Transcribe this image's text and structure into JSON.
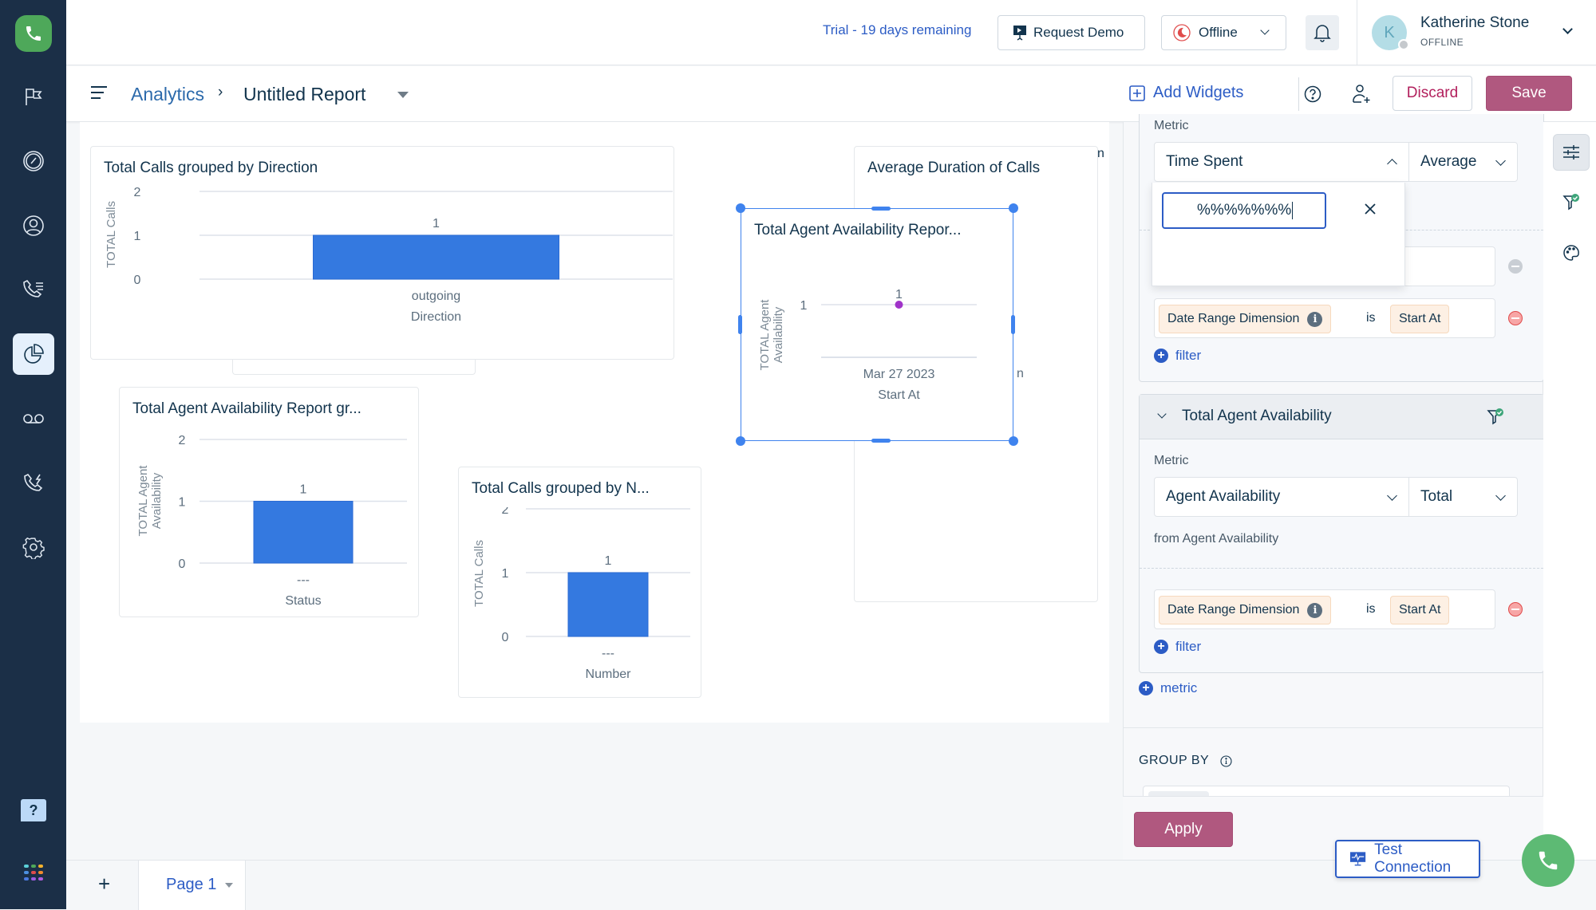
{
  "sidebar": {
    "items": [
      {
        "name": "phone-logo",
        "icon": "phone-icon"
      },
      {
        "name": "tickets",
        "icon": "flag-icon"
      },
      {
        "name": "dashboard",
        "icon": "speedometer-icon"
      },
      {
        "name": "contacts",
        "icon": "user-circle-icon"
      },
      {
        "name": "call-queues",
        "icon": "phone-list-icon"
      },
      {
        "name": "analytics",
        "icon": "pie-chart-icon",
        "active": true
      },
      {
        "name": "voicemail",
        "icon": "voicemail-icon"
      },
      {
        "name": "call-routing",
        "icon": "phone-forward-icon"
      },
      {
        "name": "settings",
        "icon": "gear-icon"
      },
      {
        "name": "help",
        "icon": "help-icon",
        "label": "?"
      },
      {
        "name": "apps",
        "icon": "apps-grid-icon"
      }
    ]
  },
  "topbar": {
    "trial_text": "Trial - 19 days remaining",
    "request_demo_label": "Request Demo",
    "status_select": "Offline",
    "user": {
      "name": "Katherine Stone",
      "status": "OFFLINE",
      "initial": "K"
    }
  },
  "subbar": {
    "breadcrumb_root": "Analytics",
    "breadcrumb_sep": "›",
    "report_title": "Untitled Report",
    "add_widgets_label": "Add Widgets",
    "discard_label": "Discard",
    "save_label": "Save"
  },
  "widgets": {
    "w1": {
      "title": "Total Calls grouped by Direction"
    },
    "w2": {
      "title": "Average Duration of Calls"
    },
    "w3": {
      "title": "Total Agent Availability Repor..."
    },
    "w4": {
      "title": "Total Agent Availability Report gr..."
    },
    "w5": {
      "title": "Total Calls grouped by N..."
    },
    "partial_text": "n"
  },
  "chart_data": [
    {
      "type": "bar",
      "title": "Total Calls grouped by Direction",
      "categories": [
        "outgoing"
      ],
      "values": [
        1
      ],
      "data_labels": [
        "1"
      ],
      "xlabel": "Direction",
      "ylabel": "TOTAL Calls",
      "yticks": [
        "0",
        "1",
        "2"
      ],
      "ylim": [
        0,
        2
      ],
      "grid": true,
      "color": "#3479e0"
    },
    {
      "type": "line",
      "title": "Total Agent Availability Repor...",
      "categories": [
        "Mar 27 2023"
      ],
      "values": [
        1
      ],
      "data_labels": [
        "1"
      ],
      "xlabel": "Start At",
      "ylabel": "TOTAL Agent Availability",
      "yticks": [
        "1"
      ],
      "grid": true,
      "color": "#a033c9"
    },
    {
      "type": "bar",
      "title": "Total Agent Availability Report gr...",
      "categories": [
        "---"
      ],
      "values": [
        1
      ],
      "data_labels": [
        "1"
      ],
      "xlabel": "Status",
      "ylabel": "TOTAL Agent Availability",
      "yticks": [
        "0",
        "1",
        "2"
      ],
      "ylim": [
        0,
        2
      ],
      "grid": true,
      "color": "#3479e0"
    },
    {
      "type": "bar",
      "title": "Total Calls grouped by N...",
      "categories": [
        "---"
      ],
      "values": [
        1
      ],
      "data_labels": [
        "1"
      ],
      "xlabel": "Number",
      "ylabel": "TOTAL Calls",
      "yticks": [
        "0",
        "1",
        "2"
      ],
      "ylim": [
        0,
        2
      ],
      "grid": true,
      "color": "#3479e0"
    }
  ],
  "panel": {
    "metric_label": "Metric",
    "metric1": {
      "field": "Time Spent",
      "aggregation": "Average",
      "search_value": "%%%%%%%",
      "filter": {
        "dimension": "Date Range Dimension",
        "operator": "is",
        "value": "Start At"
      },
      "add_filter": "filter"
    },
    "metric2": {
      "header": "Total Agent Availability",
      "field": "Agent Availability",
      "aggregation": "Total",
      "source": "from Agent Availability",
      "filter": {
        "dimension": "Date Range Dimension",
        "operator": "is",
        "value": "Start At"
      },
      "add_filter": "filter"
    },
    "add_metric": "metric",
    "group_by_label": "GROUP BY",
    "apply_label": "Apply"
  },
  "footer": {
    "add_page": "+",
    "page_tab": "Page 1",
    "test_connection": "Test Connection"
  },
  "colors": {
    "accent": "#2c5cc5",
    "primary_button": "#b0587f",
    "sidebar": "#1b2f47",
    "bar": "#3479e0",
    "point": "#a033c9",
    "call_green": "#5dba74"
  }
}
